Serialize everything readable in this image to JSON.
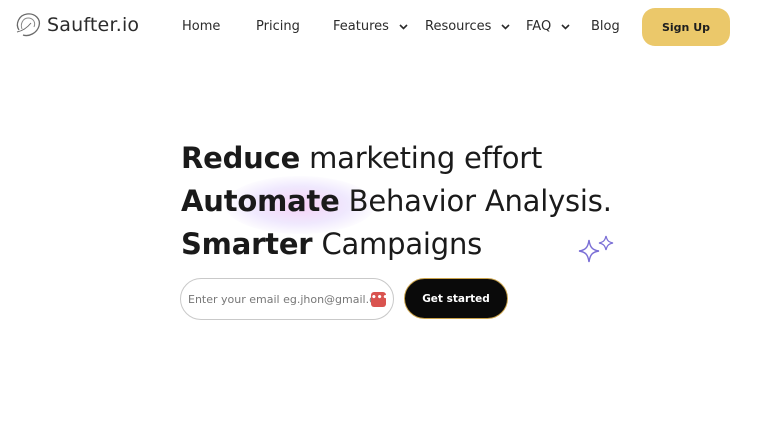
{
  "brand": {
    "name": "Saufter.io"
  },
  "nav": {
    "home": "Home",
    "pricing": "Pricing",
    "features": "Features",
    "resources": "Resources",
    "faq": "FAQ",
    "blog": "Blog",
    "signup": "Sign Up"
  },
  "hero": {
    "line1_bold": "Reduce",
    "line1_rest": " marketing effort",
    "line2_bold": "Automate",
    "line2_rest": " Behavior Analysis.",
    "line3_bold": "Smarter",
    "line3_rest": " Campaigns"
  },
  "signup_form": {
    "email_placeholder": "Enter your email eg.jhon@gmail.com",
    "cta_label": "Get started"
  },
  "colors": {
    "accent": "#ebc86a",
    "cta_bg": "#0a0a0a",
    "sparkle": "#7b6fd6"
  },
  "icons": [
    "logo-mark-icon",
    "chevron-down-icon",
    "sparkles-icon",
    "password-manager-icon"
  ]
}
